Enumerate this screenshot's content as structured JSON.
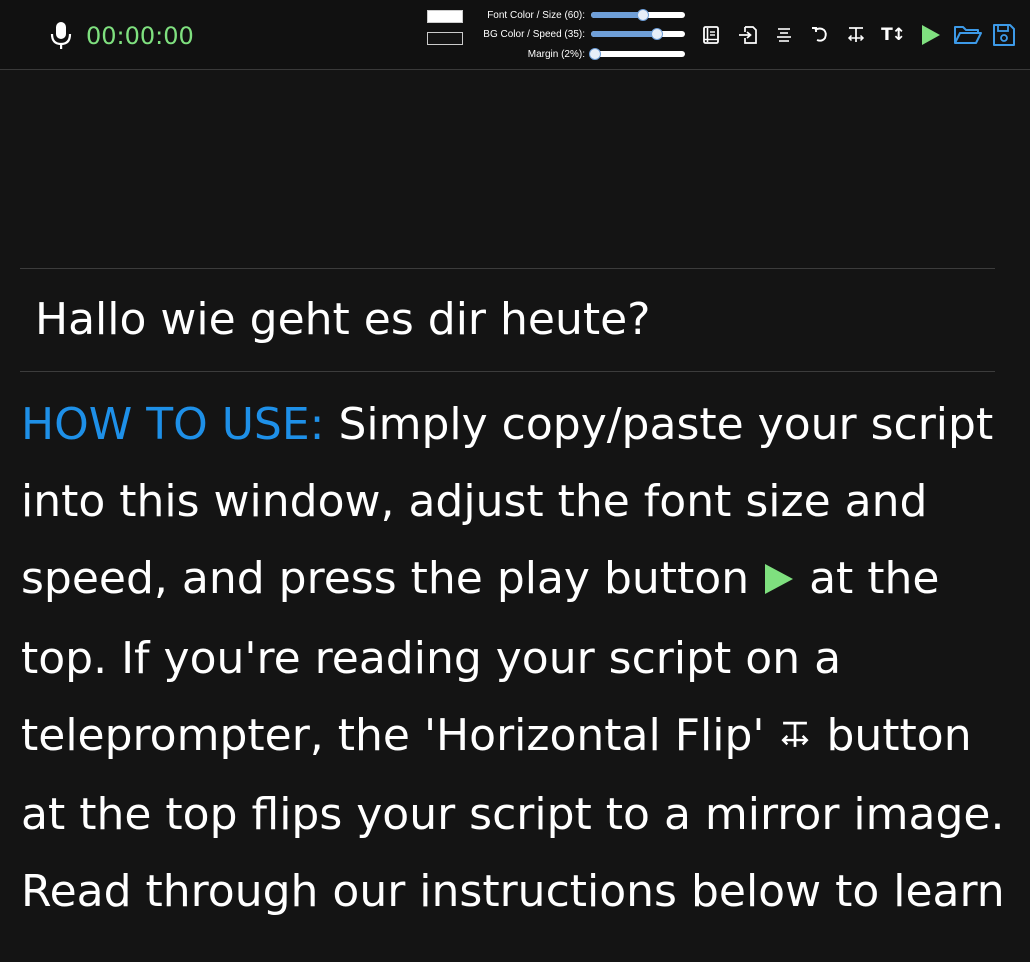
{
  "toolbar": {
    "timer": "00:00:00",
    "sliders": [
      {
        "label": "Font Color / Size (60):",
        "value": 60,
        "fraction": 0.55
      },
      {
        "label": "BG Color / Speed (35):",
        "value": 35,
        "fraction": 0.7
      },
      {
        "label": "Margin (2%):",
        "value": 2,
        "fraction": 0.04
      }
    ],
    "font_color": "#ffffff",
    "bg_color": "#141414",
    "icons": [
      "manual-icon",
      "import-icon",
      "center-align-icon",
      "reset-icon",
      "horizontal-flip-icon",
      "text-size-icon",
      "play-icon",
      "open-folder-icon",
      "save-icon"
    ],
    "text_size_glyph": "T↕",
    "accent_green": "#7fe07f",
    "accent_blue": "#3d9ae8"
  },
  "prompter": {
    "current_line": "Hallo wie geht es dir heute?",
    "script": {
      "heading": "HOW TO USE:",
      "part1": " Simply copy/paste your script into this window, adjust the font size and speed, and press the play button ",
      "part2": " at the top.   If you're reading your script on a teleprompter, the 'Horizontal Flip' ",
      "part3": " button at the top flips your script to a mirror image.   Read through our instructions below to learn"
    }
  }
}
